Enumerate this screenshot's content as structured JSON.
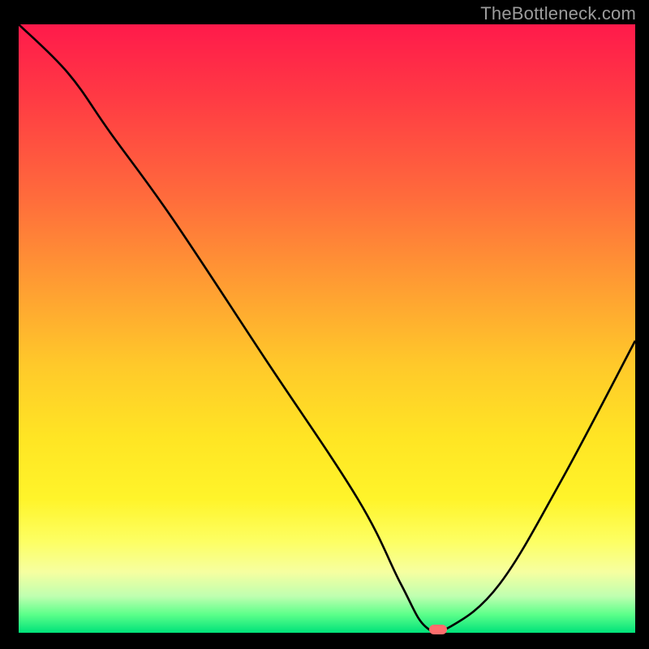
{
  "watermark": {
    "text": "TheBottleneck.com"
  },
  "chart_data": {
    "type": "line",
    "title": "",
    "xlabel": "",
    "ylabel": "",
    "xlim": [
      0,
      100
    ],
    "ylim": [
      0,
      100
    ],
    "grid": false,
    "legend": false,
    "background_gradient": {
      "direction": "vertical",
      "stops": [
        {
          "pct": 0,
          "color": "#ff1a4b"
        },
        {
          "pct": 28,
          "color": "#ff6a3c"
        },
        {
          "pct": 56,
          "color": "#ffc92a"
        },
        {
          "pct": 78,
          "color": "#fff42a"
        },
        {
          "pct": 94,
          "color": "#bfffb0"
        },
        {
          "pct": 100,
          "color": "#00e27a"
        }
      ]
    },
    "series": [
      {
        "name": "bottleneck-curve",
        "color": "#000000",
        "x": [
          0,
          8,
          15,
          25,
          40,
          55,
          62,
          66,
          70,
          78,
          88,
          100
        ],
        "y": [
          100,
          92,
          82,
          68,
          45,
          22,
          8,
          1,
          1,
          8,
          25,
          48
        ]
      }
    ],
    "marker": {
      "x": 68,
      "y": 0.6,
      "color": "#ff6d6d",
      "shape": "pill"
    }
  }
}
